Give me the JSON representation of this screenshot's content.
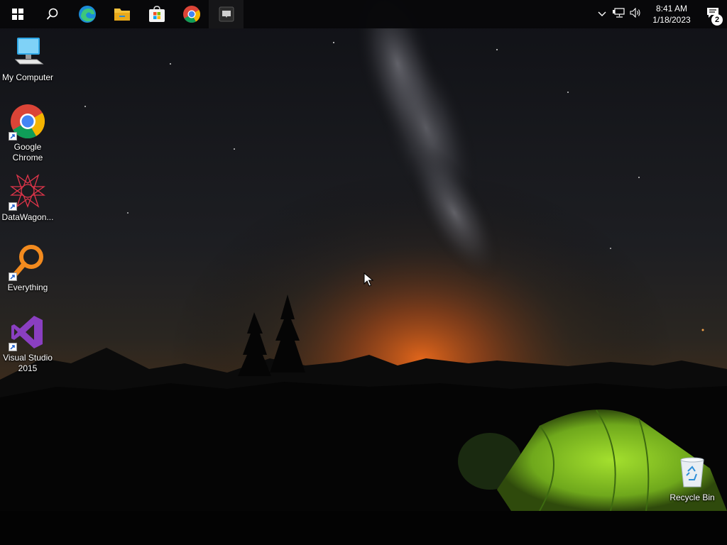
{
  "taskbar": {
    "start_icon": "windows-logo-icon",
    "search_icon": "search-icon",
    "pinned_apps": [
      {
        "name": "edge-icon"
      },
      {
        "name": "file-explorer-icon"
      },
      {
        "name": "microsoft-store-icon"
      },
      {
        "name": "chrome-icon"
      },
      {
        "name": "terminal-app-icon"
      }
    ]
  },
  "tray": {
    "chevron": "chevron-up-icon",
    "network": "network-icon",
    "volume": "volume-icon",
    "time": "8:41 AM",
    "date": "1/18/2023",
    "notifications_count": "2"
  },
  "desktop": {
    "icons": [
      {
        "label": "My Computer"
      },
      {
        "label": "Google Chrome"
      },
      {
        "label": "DataWagon..."
      },
      {
        "label": "Everything"
      },
      {
        "label": "Visual Studio 2015"
      },
      {
        "label": "Recycle Bin"
      }
    ]
  },
  "colors": {
    "sky_top": "#111217",
    "horizon_glow": "#d9641c",
    "tent": "#9bd62b",
    "taskbar": "#08080a"
  }
}
